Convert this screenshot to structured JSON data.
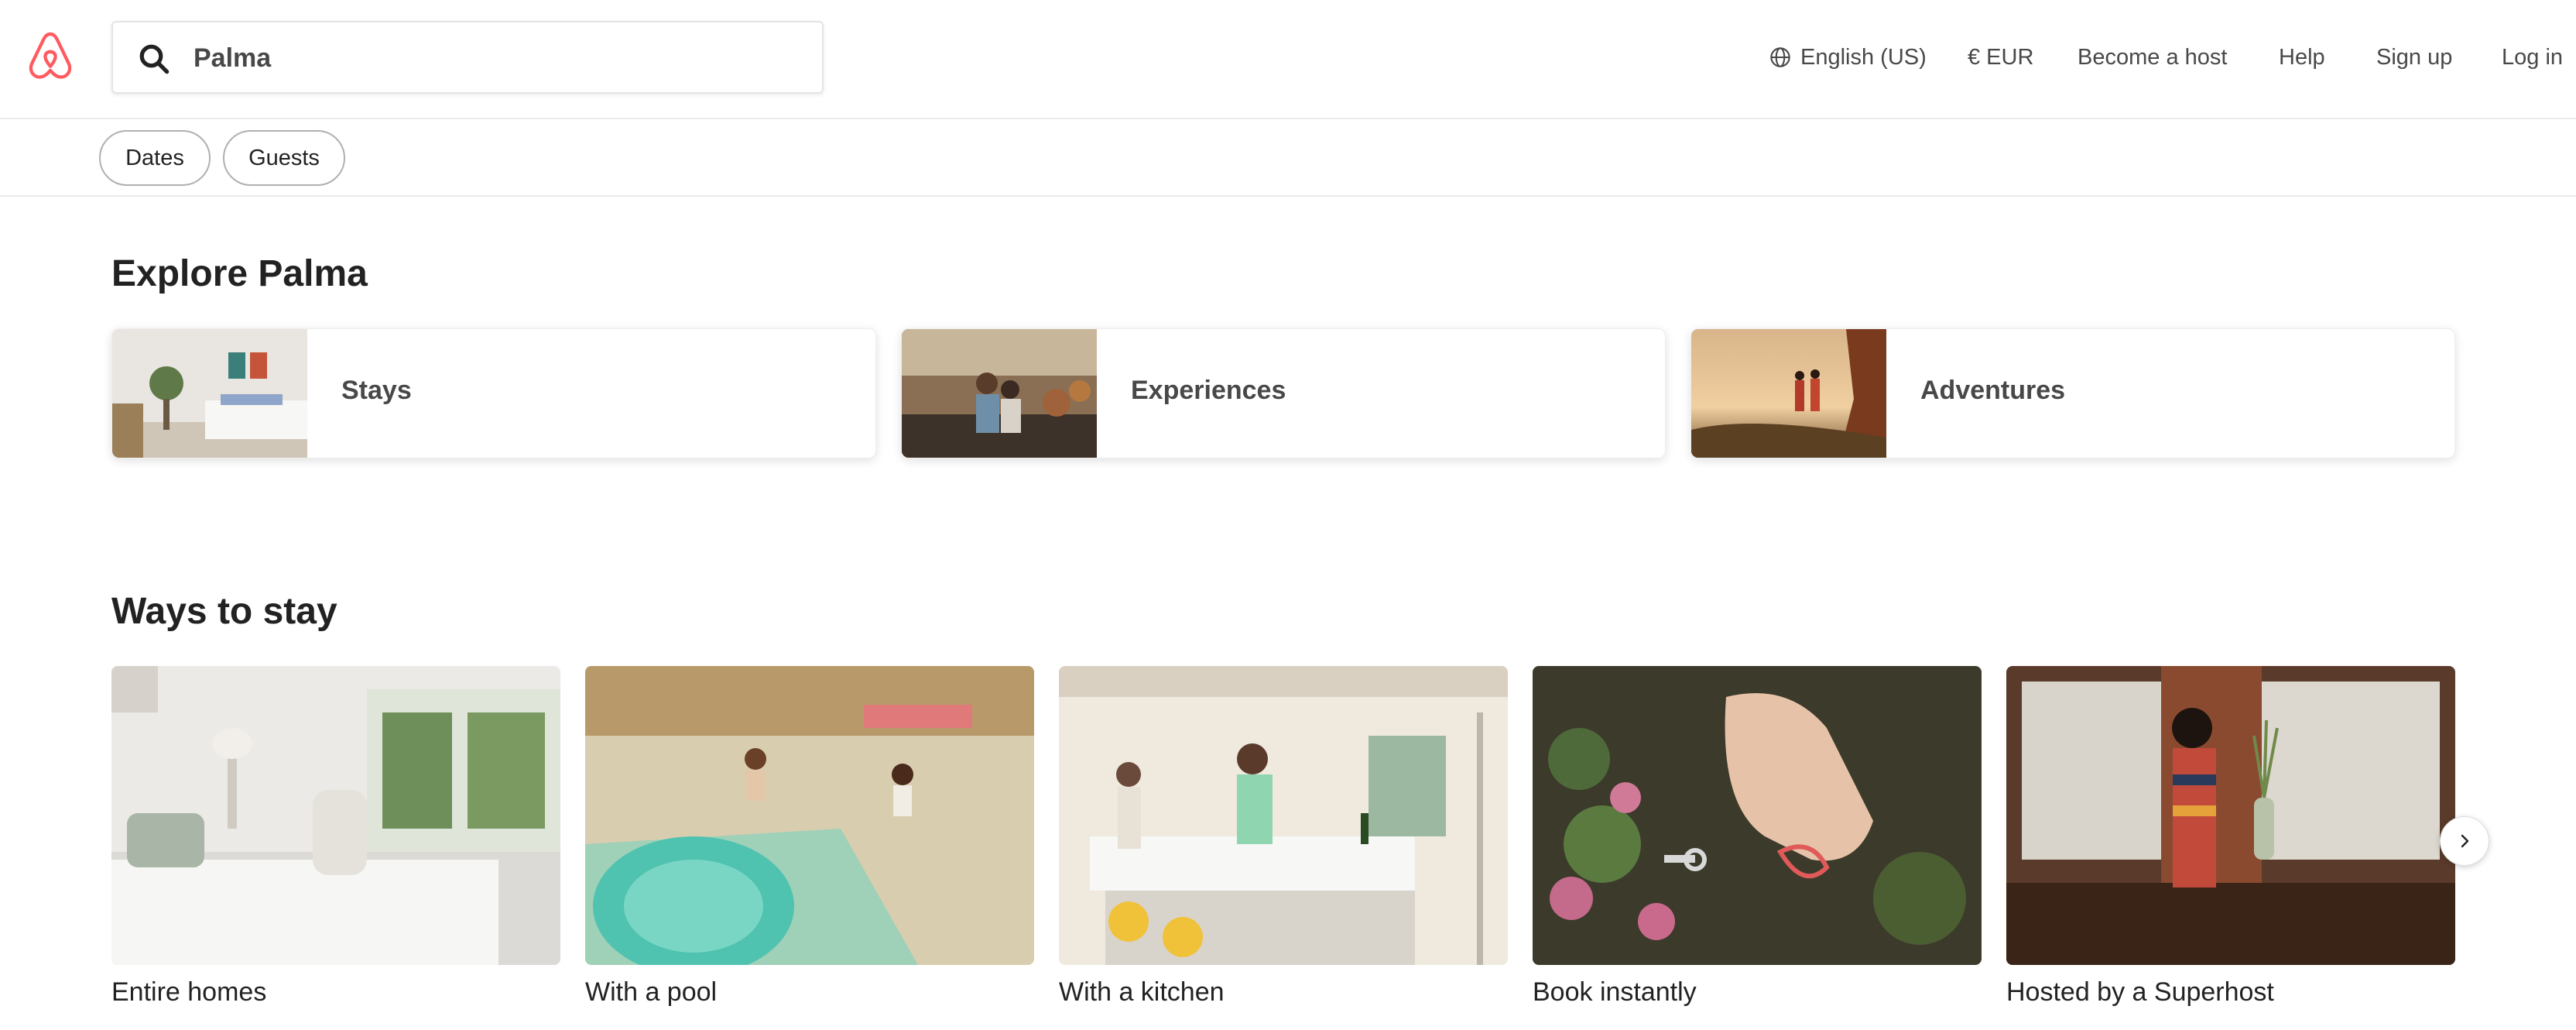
{
  "header": {
    "search": {
      "value": "Palma",
      "placeholder": ""
    },
    "nav": {
      "language": "English (US)",
      "currency": "€ EUR",
      "become_host": "Become a host",
      "help": "Help",
      "sign_up": "Sign up",
      "log_in": "Log in"
    }
  },
  "filters": {
    "dates": "Dates",
    "guests": "Guests"
  },
  "explore": {
    "title": "Explore Palma",
    "cards": [
      {
        "label": "Stays"
      },
      {
        "label": "Experiences"
      },
      {
        "label": "Adventures"
      }
    ]
  },
  "ways_to_stay": {
    "title": "Ways to stay",
    "cards": [
      {
        "label": "Entire homes"
      },
      {
        "label": "With a pool"
      },
      {
        "label": "With a kitchen"
      },
      {
        "label": "Book instantly"
      },
      {
        "label": "Hosted by a Superhost"
      }
    ]
  },
  "colors": {
    "brand": "#FF5A5F",
    "text": "#222222",
    "muted": "#484848",
    "border": "#EBEBEB"
  },
  "icons": [
    "airbnb-logo",
    "search-icon",
    "globe-icon",
    "chevron-right-icon"
  ]
}
